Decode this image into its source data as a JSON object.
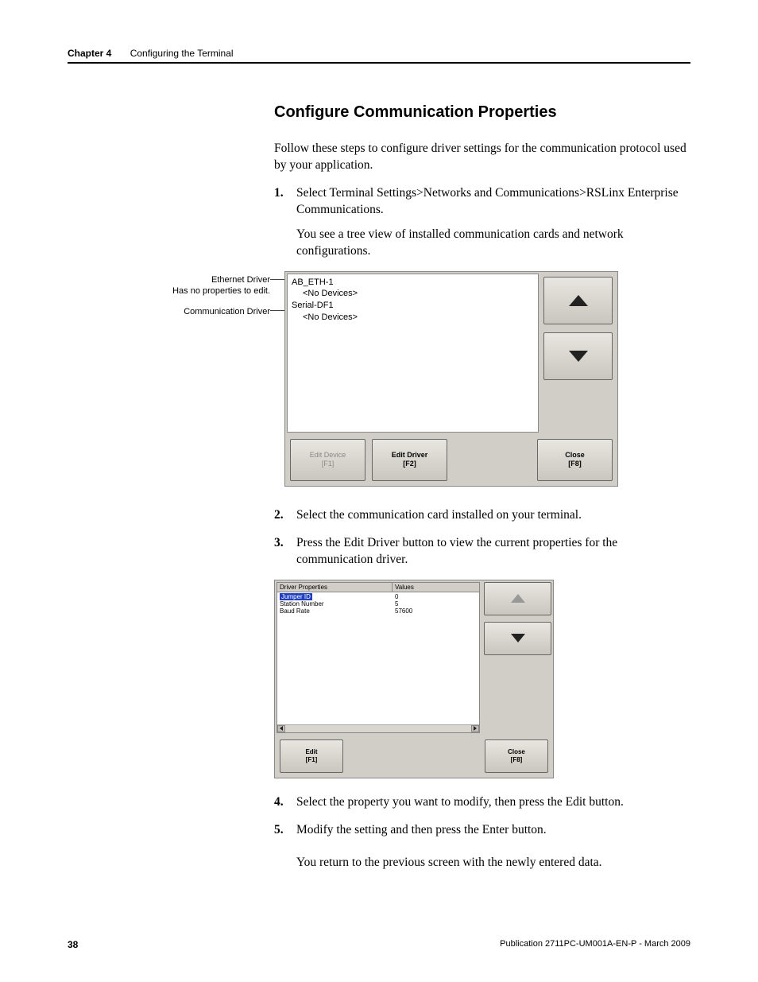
{
  "header": {
    "chapter": "Chapter 4",
    "title": "Configuring the Terminal"
  },
  "section_title": "Configure Communication Properties",
  "intro": "Follow these steps to configure driver settings for the communication protocol used by your application.",
  "steps": {
    "s1": "Select Terminal Settings>Networks and Communications>RSLinx Enterprise Communications.",
    "s1_sub": "You see a tree view of installed communication cards and network configurations.",
    "s2": "Select the communication card installed on your terminal.",
    "s3": "Press the Edit Driver button to view the current properties for the communication driver.",
    "s4": "Select the property you want to modify, then press the Edit button.",
    "s5": "Modify the setting and then press the Enter button.",
    "s5_sub": "You return to the previous screen with the newly entered data."
  },
  "callouts": {
    "c1a": "Ethernet Driver",
    "c1b": "Has no properties to edit.",
    "c2": "Communication Driver"
  },
  "fig1": {
    "tree": {
      "n1": "AB_ETH-1",
      "n1c": "<No Devices>",
      "n2": "Serial-DF1",
      "n2c": "<No Devices>"
    },
    "btn_edit_device": "Edit Device",
    "btn_edit_device_key": "[F1]",
    "btn_edit_driver": "Edit Driver",
    "btn_edit_driver_key": "[F2]",
    "btn_close": "Close",
    "btn_close_key": "[F8]"
  },
  "fig2": {
    "header_props": "Driver Properties",
    "header_vals": "Values",
    "rows": {
      "r1p": "Jumper ID",
      "r1v": "0",
      "r2p": "Station Number",
      "r2v": "5",
      "r3p": "Baud Rate",
      "r3v": "57600"
    },
    "btn_edit": "Edit",
    "btn_edit_key": "[F1]",
    "btn_close": "Close",
    "btn_close_key": "[F8]"
  },
  "footer": {
    "page": "38",
    "pub": "Publication 2711PC-UM001A-EN-P - March 2009"
  }
}
